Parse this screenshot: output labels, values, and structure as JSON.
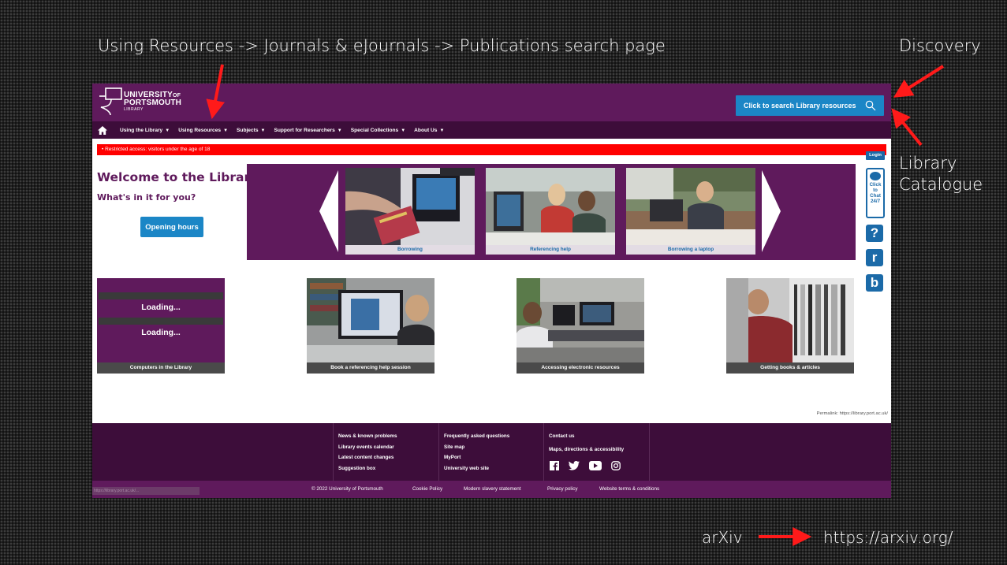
{
  "slide": {
    "path_caption": "Using Resources -> Journals & eJournals -> Publications search page",
    "discovery_caption": "Discovery",
    "catalogue_caption_line1": "Library",
    "catalogue_caption_line2": "Catalogue",
    "arxiv_label": "arXiv",
    "arxiv_url": "https://arxiv.org/",
    "arrow_color": "#ff1a1a"
  },
  "site": {
    "logo": {
      "line1": "UNIVERSITY",
      "of": "OF",
      "line2": "PORTSMOUTH",
      "line3": "LIBRARY"
    },
    "search_button": "Click to search Library resources",
    "nav": {
      "items": [
        "Using the Library",
        "Using Resources",
        "Subjects",
        "Support for Researchers",
        "Special Collections",
        "About Us"
      ],
      "caret": "▼"
    },
    "alert": "• Restricted access: visitors under the age of 18",
    "login": "Login",
    "chat": {
      "line1": "Click",
      "line2": "to",
      "line3": "Chat",
      "line4": "24/7"
    },
    "side_icons": {
      "help": "?",
      "r": "r",
      "b": "b"
    },
    "welcome_title": "Welcome to the Library",
    "welcome_sub": "What's in it for you?",
    "opening_hours": "Opening hours",
    "carousel": [
      "Borrowing",
      "Referencing help",
      "Borrowing a laptop"
    ],
    "tiles": {
      "computers": "Computers in the Library",
      "loading_1": "Loading...",
      "loading_2": "Loading...",
      "referencing": "Book a referencing help session",
      "electronic": "Accessing electronic resources",
      "books": "Getting books & articles"
    },
    "permalink": "Permalink: https://library.port.ac.uk/",
    "footer": {
      "col1": [
        "News & known problems",
        "Library events calendar",
        "Latest content changes",
        "Suggestion box"
      ],
      "col2": [
        "Frequently asked questions",
        "Site map",
        "MyPort",
        "University web site"
      ],
      "col3": [
        "Contact us",
        "Maps, directions & accessibility"
      ],
      "social_icons": [
        "facebook-icon",
        "twitter-icon",
        "youtube-icon",
        "instagram-icon"
      ]
    },
    "bottom": {
      "copyright": "© 2022 University of Portsmouth",
      "cookie": "Cookie Policy",
      "slavery": "Modern slavery statement",
      "privacy": "Privacy policy",
      "terms": "Website terms & conditions",
      "status_url": "https://library.port.ac.uk/..."
    },
    "colors": {
      "purple": "#5f1a5c",
      "dark_purple": "#3d0d3a",
      "blue": "#1b86c6",
      "alert_red": "#ff0000"
    }
  }
}
